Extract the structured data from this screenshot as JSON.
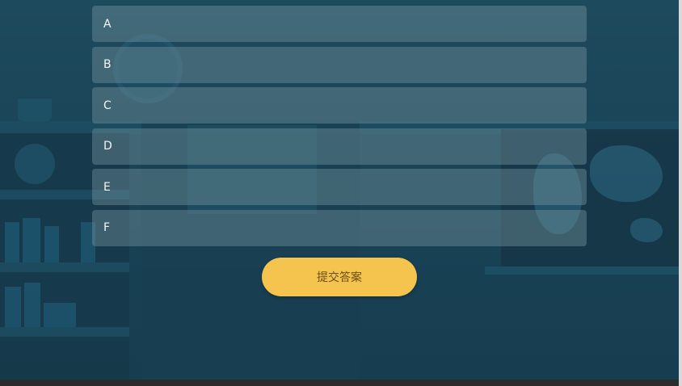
{
  "quiz": {
    "options": [
      {
        "label": "A"
      },
      {
        "label": "B"
      },
      {
        "label": "C"
      },
      {
        "label": "D"
      },
      {
        "label": "E"
      },
      {
        "label": "F"
      }
    ],
    "submit_label": "提交答案"
  },
  "colors": {
    "background": "#1a4457",
    "option_fill": "#587f8c",
    "submit_button": "#f5c44e",
    "submit_text": "#6b4d12"
  }
}
